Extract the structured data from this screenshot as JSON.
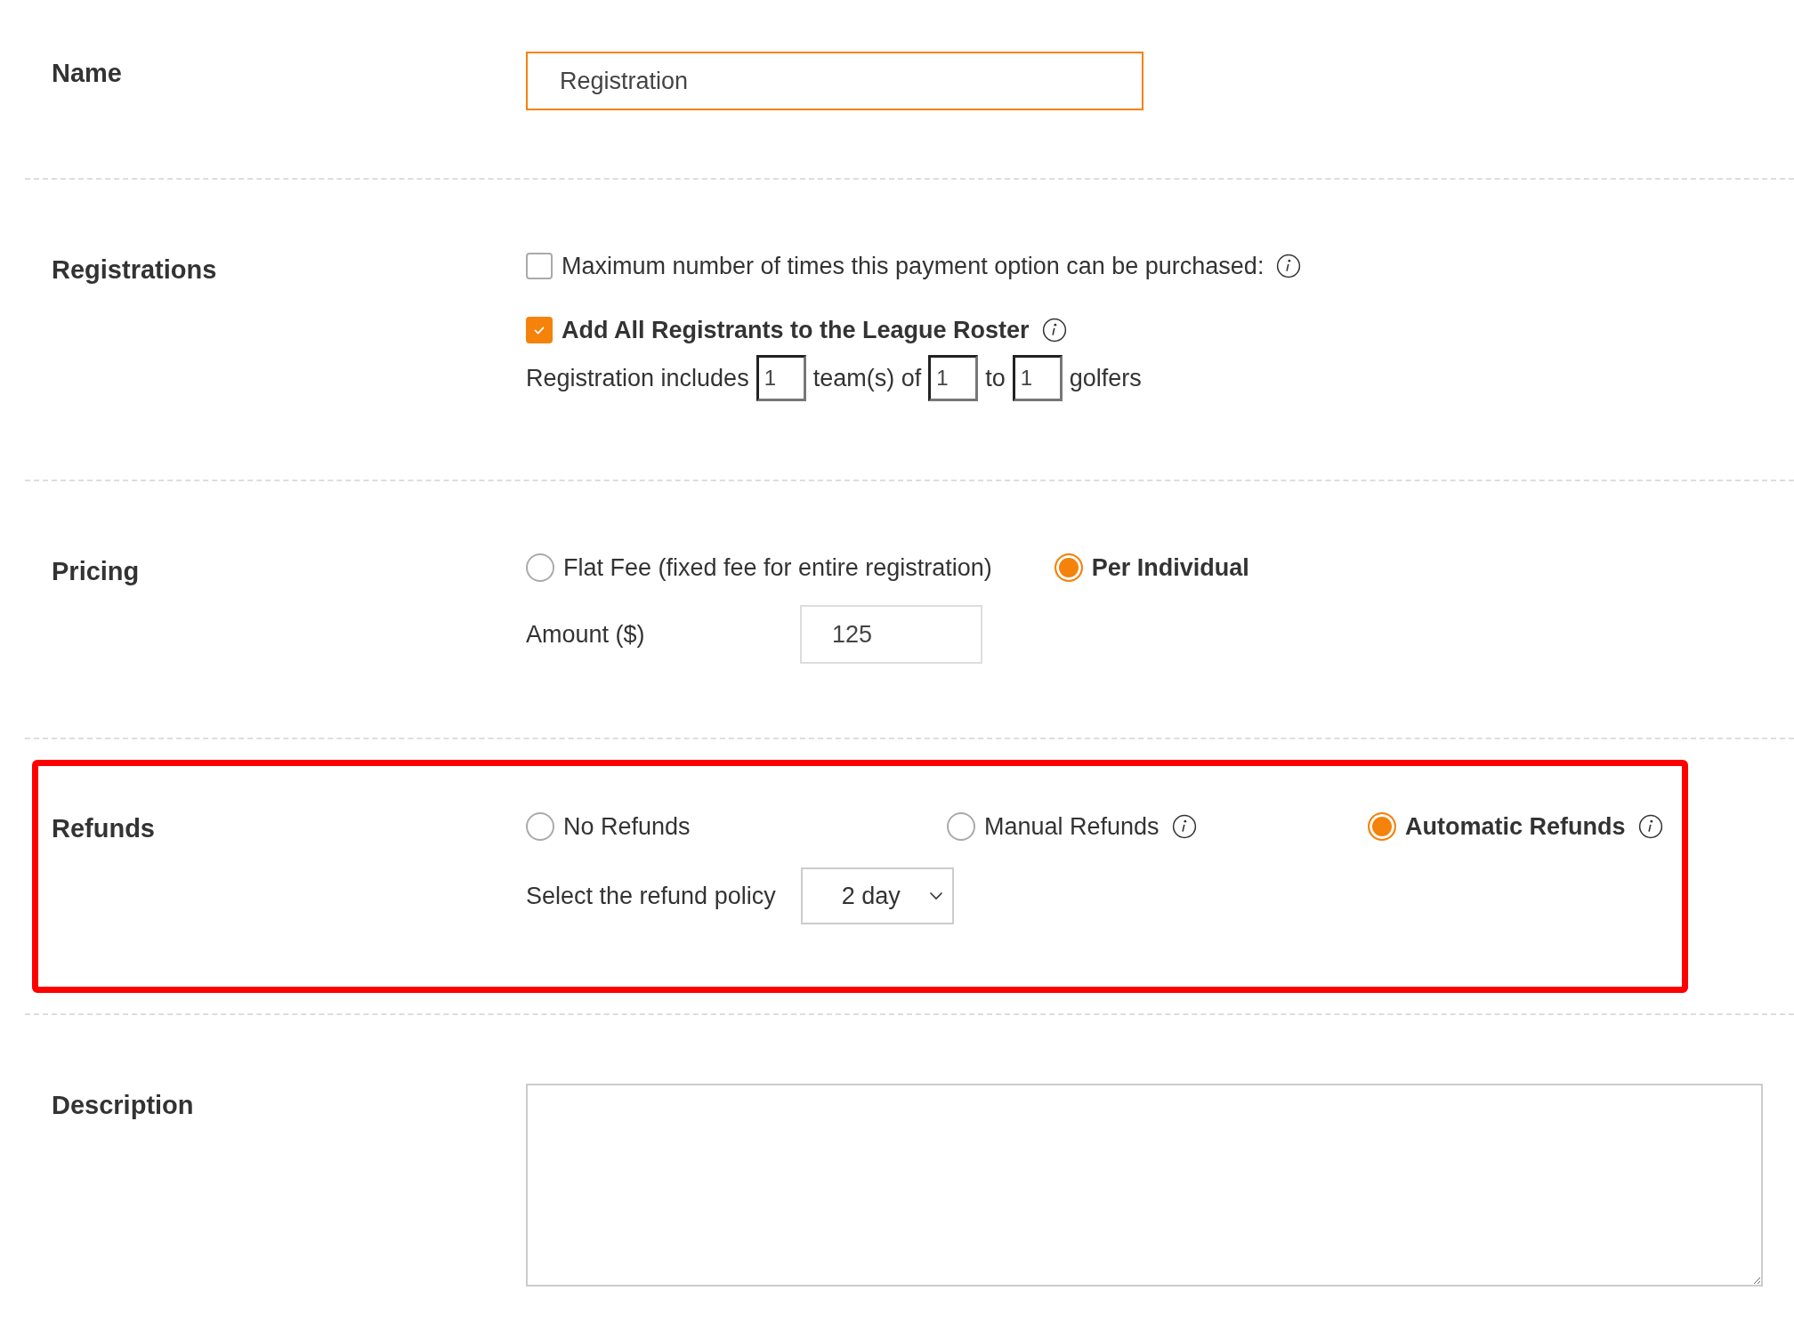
{
  "name": {
    "label": "Name",
    "value": "Registration",
    "focused": true
  },
  "registrations": {
    "label": "Registrations",
    "options": [
      {
        "label": "Maximum number of times this payment option can be purchased:",
        "checked": false,
        "info": true
      },
      {
        "label": "Add All Registrants to the League Roster",
        "checked": true,
        "info": true
      }
    ],
    "team_sentence": [
      {
        "kind": "text",
        "text": "Registration includes"
      },
      {
        "kind": "input",
        "value": "1"
      },
      {
        "kind": "text",
        "text": "team(s) of"
      },
      {
        "kind": "input",
        "value": "1"
      },
      {
        "kind": "text",
        "text": "to"
      },
      {
        "kind": "input",
        "value": "1"
      },
      {
        "kind": "text",
        "text": "golfers"
      }
    ]
  },
  "pricing": {
    "label": "Pricing",
    "options": [
      {
        "label": "Flat Fee (fixed fee for entire registration)",
        "selected": false,
        "info": false
      },
      {
        "label": "Per Individual",
        "selected": true,
        "info": false
      }
    ],
    "amount": {
      "label": "Amount ($)",
      "value": "125"
    }
  },
  "refunds": {
    "label": "Refunds",
    "highlighted": true,
    "options": [
      {
        "label": "No Refunds",
        "selected": false,
        "info": false
      },
      {
        "label": "Manual Refunds",
        "selected": false,
        "info": true
      },
      {
        "label": "Automatic Refunds",
        "selected": true,
        "info": true
      }
    ],
    "policy": {
      "label": "Select the refund policy",
      "value": "2 day"
    }
  },
  "description": {
    "label": "Description"
  }
}
